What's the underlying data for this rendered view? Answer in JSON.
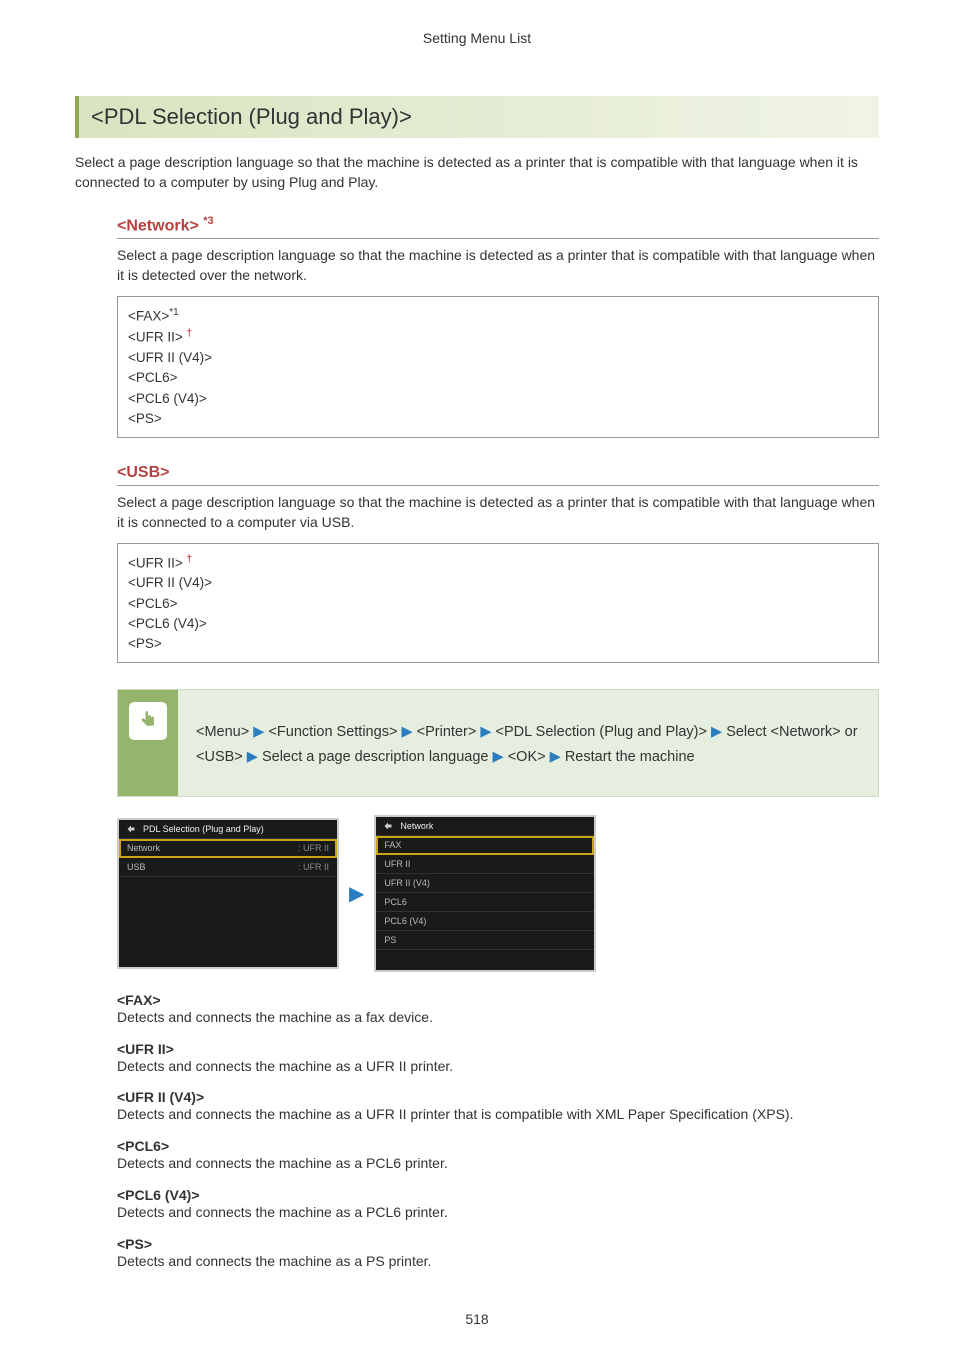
{
  "header": {
    "title": "Setting Menu List"
  },
  "main": {
    "heading": "<PDL Selection (Plug and Play)>",
    "intro": "Select a page description language so that the machine is detected as a printer that is compatible with that language when it is connected to a computer by using Plug and Play."
  },
  "network": {
    "heading": "<Network>",
    "sup": "*3",
    "desc": "Select a page description language so that the machine is detected as a printer that is compatible with that language when it is detected over the network.",
    "options": {
      "fax": "<FAX>",
      "fax_sup": "*1",
      "ufr2": "<UFR II>",
      "ufr2v4": "<UFR II (V4)>",
      "pcl6": "<PCL6>",
      "pcl6v4": "<PCL6 (V4)>",
      "ps": "<PS>"
    }
  },
  "usb": {
    "heading": "<USB>",
    "desc": "Select a page description language so that the machine is detected as a printer that is compatible with that language when it is connected to a computer via USB.",
    "options": {
      "ufr2": "<UFR II>",
      "ufr2v4": "<UFR II (V4)>",
      "pcl6": "<PCL6>",
      "pcl6v4": "<PCL6 (V4)>",
      "ps": "<PS>"
    }
  },
  "navpath": {
    "menu": "<Menu>",
    "fs": "<Function Settings>",
    "printer": "<Printer>",
    "pdl": "<PDL Selection (Plug and Play)>",
    "select_net_usb": "Select <Network> or <USB>",
    "select_lang": "Select a page description language",
    "ok": "<OK>",
    "restart": "Restart the machine"
  },
  "screens": {
    "left": {
      "title": "PDL Selection (Plug and Play)",
      "rows": [
        {
          "label": "Network",
          "value": ": UFR II"
        },
        {
          "label": "USB",
          "value": ": UFR II"
        }
      ]
    },
    "right": {
      "title": "Network",
      "rows": [
        {
          "label": "FAX"
        },
        {
          "label": "UFR II"
        },
        {
          "label": "UFR II (V4)"
        },
        {
          "label": "PCL6"
        },
        {
          "label": "PCL6 (V4)"
        },
        {
          "label": "PS"
        }
      ]
    }
  },
  "definitions": [
    {
      "title": "<FAX>",
      "body": "Detects and connects the machine as a fax device."
    },
    {
      "title": "<UFR II>",
      "body": "Detects and connects the machine as a UFR II printer."
    },
    {
      "title": "<UFR II (V4)>",
      "body": "Detects and connects the machine as a UFR II printer that is compatible with XML Paper Specification (XPS)."
    },
    {
      "title": "<PCL6>",
      "body": "Detects and connects the machine as a PCL6 printer."
    },
    {
      "title": "<PCL6 (V4)>",
      "body": "Detects and connects the machine as a PCL6 printer."
    },
    {
      "title": "<PS>",
      "body": "Detects and connects the machine as a PS printer."
    }
  ],
  "page_number": "518"
}
